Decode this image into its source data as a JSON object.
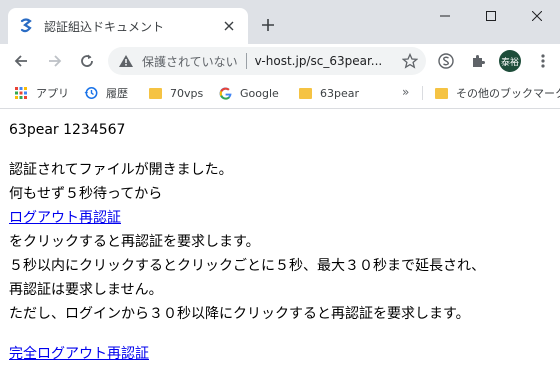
{
  "browser": {
    "tab": {
      "title": "認証組込ドキュメント",
      "favicon": "s-logo-icon"
    },
    "new_tab_label": "+",
    "window_controls": [
      "minimize",
      "maximize",
      "close"
    ],
    "omnibox": {
      "security_status": "保護されていない",
      "url": "v-host.jp/sc_63pear..."
    },
    "profile": {
      "avatar_text": "泰裕",
      "avatar_color": "#1e4d3a"
    },
    "bookmarks": [
      {
        "label": "アプリ",
        "icon": "apps-grid-icon"
      },
      {
        "label": "履歴",
        "icon": "history-icon"
      },
      {
        "label": "70vps",
        "icon": "folder-icon"
      },
      {
        "label": "Google",
        "icon": "google-g-icon"
      },
      {
        "label": "63pear",
        "icon": "folder-icon"
      }
    ],
    "bookmarks_overflow": "»",
    "other_bookmarks": "その他のブックマーク"
  },
  "page": {
    "heading": "63pear 1234567",
    "line_opened": "認証されてファイルが開きました。",
    "line_wait": "何もせず５秒待ってから",
    "link_logout_reauth": "ログアウト再認証",
    "line_click": "をクリックすると再認証を要求します。",
    "line_extend": "５秒以内にクリックするとクリックごとに５秒、最大３０秒まで延長され、",
    "line_no_reauth": "再認証は要求しません。",
    "line_after30": "ただし、ログインから３０秒以降にクリックすると再認証を要求します。",
    "link_full_logout": "完全ログアウト再認証"
  },
  "colors": {
    "titlebar_bg": "#dee1e6",
    "link": "#0000ee",
    "omnibox_bg": "#f1f3f4"
  }
}
